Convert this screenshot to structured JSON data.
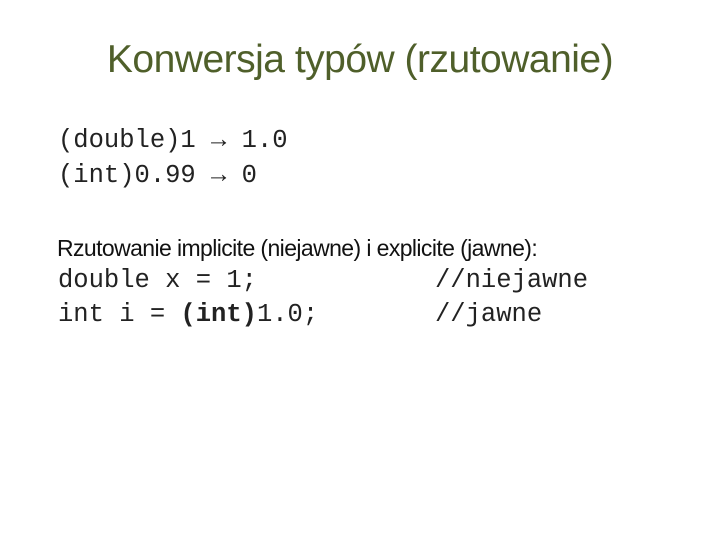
{
  "slide": {
    "title": "Konwersja typów (rzutowanie)",
    "examples": [
      {
        "expr": "(double)1",
        "arrow": "→",
        "result": "1.0"
      },
      {
        "expr": "(int)0.99",
        "arrow": "→",
        "result": "0"
      }
    ],
    "subheading": "Rzutowanie implicite (niejawne) i explicite (jawne):",
    "code_lines": [
      {
        "pre": "double x = 1;",
        "cast": "",
        "post": "",
        "comment": "//niejawne"
      },
      {
        "pre": "int i = ",
        "cast": "(int)",
        "post": "1.0;",
        "comment": "//jawne"
      }
    ],
    "colors": {
      "title": "#4f5f2a"
    }
  }
}
